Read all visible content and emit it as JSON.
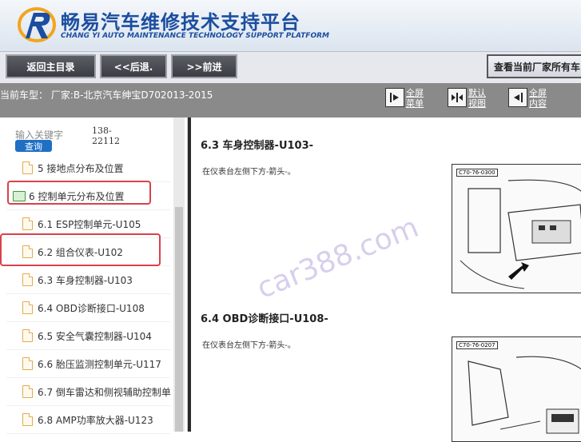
{
  "header": {
    "title_cn": "畅易汽车维修技术支持平台",
    "title_en": "CHANG YI AUTO MAINTENANCE TECHNOLOGY SUPPORT PLATFORM"
  },
  "toolbar": {
    "home_label": "返回主目录",
    "back_label": "<<后退.",
    "forward_label": ">>前进",
    "view_all_label": "查看当前厂家所有车"
  },
  "model_bar": {
    "current_model": "当前车型：  厂家:B-北京汽车绅宝D702013-2015",
    "buttons": [
      {
        "label": "全屏菜单",
        "icon": "arrow-right-icon"
      },
      {
        "label": "默认视图",
        "icon": "split-view-icon"
      },
      {
        "label": "全屏内容",
        "icon": "arrow-left-icon"
      }
    ]
  },
  "sidebar": {
    "search_label": "输入关键字",
    "search_button": "查询",
    "keyword_code_1": "138-",
    "keyword_code_2": "22112",
    "items": [
      {
        "label": "5 接地点分布及位置",
        "type": "doc"
      },
      {
        "label": "6 控制单元分布及位置",
        "type": "folder"
      },
      {
        "label": "6.1 ESP控制单元-U105",
        "type": "doc"
      },
      {
        "label": "6.2 组合仪表-U102",
        "type": "doc"
      },
      {
        "label": "6.3 车身控制器-U103",
        "type": "doc"
      },
      {
        "label": "6.4 OBD诊断接口-U108",
        "type": "doc"
      },
      {
        "label": "6.5 安全气囊控制器-U104",
        "type": "doc"
      },
      {
        "label": "6.6 胎压监测控制单元-U117",
        "type": "doc"
      },
      {
        "label": "6.7 倒车雷达和侧视辅助控制单",
        "type": "doc"
      },
      {
        "label": "6.8 AMP功率放大器-U123",
        "type": "doc"
      }
    ]
  },
  "content": {
    "sections": [
      {
        "title": "6.3 车身控制器-U103-",
        "desc": "在仪表台左侧下方-箭头-。",
        "figure_code": "C70-76-0300"
      },
      {
        "title": "6.4 OBD诊断接口-U108-",
        "desc": "在仪表台左侧下方-箭头-。",
        "figure_code": "C70-76-0207"
      }
    ],
    "watermark": "car388.com"
  },
  "colors": {
    "brand_blue": "#1b4ea0",
    "highlight_red": "#d9414a",
    "toolbar_dark": "#3b3d43",
    "model_bar_grey": "#8a8a8a"
  }
}
